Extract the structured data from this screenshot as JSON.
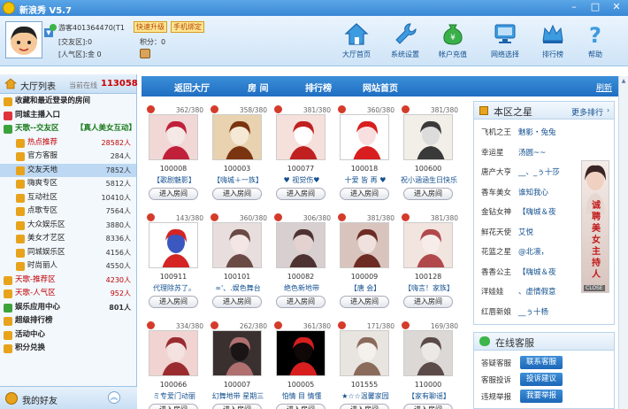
{
  "window": {
    "title": "新浪秀 V5.7"
  },
  "user": {
    "name": "游客401364470(T1",
    "upgrade_label": "快速升级",
    "bind_label": "手机绑定",
    "friend_zone_label": "[交友区]:",
    "friend_zone_value": "0",
    "points_label": "积分",
    "points_value": "0",
    "popular_zone_label": "[人气区]:",
    "popular_zone_value": "金 0"
  },
  "toolbar": [
    {
      "label": "大厅首页",
      "icon": "house-icon"
    },
    {
      "label": "系统设置",
      "icon": "wrench-icon"
    },
    {
      "label": "帐户充值",
      "icon": "money-bag-icon"
    },
    {
      "label": "网络选择",
      "icon": "network-icon"
    },
    {
      "label": "排行榜",
      "icon": "crown-icon"
    },
    {
      "label": "帮助",
      "icon": "help-icon"
    }
  ],
  "hall": {
    "title": "大厅列表",
    "online_label": "当前在线",
    "online_count": "113058"
  },
  "tree": [
    {
      "label": "收藏和最近登录的房间",
      "count": "",
      "indent": 0,
      "bold": true,
      "color": "#222222",
      "icon_color": "#e8a31c"
    },
    {
      "label": "同城主播入口",
      "count": "",
      "indent": 0,
      "bold": true,
      "color": "#222222",
      "icon_color": "#e0323c"
    },
    {
      "label": "天歌--交友区",
      "extra": "【真人美女互动】",
      "count": "",
      "indent": 0,
      "bold": true,
      "color": "#1a7a1a",
      "icon_color": "#3ca33c"
    },
    {
      "label": "热点推荐",
      "count": "28582人",
      "indent": 1,
      "bold": false,
      "color": "#c00000",
      "icon_color": "#e8a31c"
    },
    {
      "label": "官方客服",
      "count": "284人",
      "indent": 1,
      "bold": false,
      "color": "#222222",
      "icon_color": "#e8a31c"
    },
    {
      "label": "交友天地",
      "count": "7852人",
      "indent": 1,
      "bold": false,
      "color": "#222222",
      "icon_color": "#e8a31c",
      "selected": true
    },
    {
      "label": "嗨爽专区",
      "count": "5812人",
      "indent": 1,
      "bold": false,
      "color": "#222222",
      "icon_color": "#e8a31c"
    },
    {
      "label": "互动社区",
      "count": "10410人",
      "indent": 1,
      "bold": false,
      "color": "#222222",
      "icon_color": "#e8a31c"
    },
    {
      "label": "点歌专区",
      "count": "7564人",
      "indent": 1,
      "bold": false,
      "color": "#222222",
      "icon_color": "#e8a31c"
    },
    {
      "label": "大众娱乐区",
      "count": "3880人",
      "indent": 1,
      "bold": false,
      "color": "#222222",
      "icon_color": "#e8a31c"
    },
    {
      "label": "美女才艺区",
      "count": "8336人",
      "indent": 1,
      "bold": false,
      "color": "#222222",
      "icon_color": "#e8a31c"
    },
    {
      "label": "同城娱乐区",
      "count": "4156人",
      "indent": 1,
      "bold": false,
      "color": "#222222",
      "icon_color": "#e8a31c"
    },
    {
      "label": "时尚丽人",
      "count": "4550人",
      "indent": 1,
      "bold": false,
      "color": "#222222",
      "icon_color": "#e8a31c"
    },
    {
      "label": "天歌-推荐区",
      "count": "4230人",
      "indent": 0,
      "bold": false,
      "color": "#c00000",
      "icon_color": "#e8a31c"
    },
    {
      "label": "天歌-人气区",
      "count": "952人",
      "indent": 0,
      "bold": false,
      "color": "#c00000",
      "icon_color": "#e8a31c"
    },
    {
      "label": "娱乐应用中心",
      "count": "801人",
      "indent": 0,
      "bold": true,
      "color": "#222222",
      "icon_color": "#3ca33c"
    },
    {
      "label": "超级排行榜",
      "count": "",
      "indent": 0,
      "bold": true,
      "color": "#222222",
      "icon_color": "#e8a31c"
    },
    {
      "label": "活动中心",
      "count": "",
      "indent": 0,
      "bold": true,
      "color": "#222222",
      "icon_color": "#e8a31c"
    },
    {
      "label": "积分兑换",
      "count": "",
      "indent": 0,
      "bold": true,
      "color": "#222222",
      "icon_color": "#e8a31c"
    }
  ],
  "friends": {
    "label": "我的好友"
  },
  "mainnav": {
    "back": "返回大厅",
    "rooms": "房 间",
    "rank": "排行榜",
    "home": "网站首页",
    "refresh": "刷新"
  },
  "rooms": [
    {
      "count": "362/380",
      "id": "100008",
      "name": "【歌剧魅影】",
      "enter": "进入房间",
      "palette": [
        "#f1d8d6",
        "#c0203a",
        "#f4e9e6"
      ]
    },
    {
      "count": "358/380",
      "id": "100003",
      "name": "【嗨城＋一族】",
      "enter": "进入房间",
      "palette": [
        "#e8d2b0",
        "#7a3410",
        "#f5e9d6"
      ]
    },
    {
      "count": "381/380",
      "id": "100077",
      "name": "♥ 视觉伤♥",
      "enter": "进入房间",
      "palette": [
        "#f6e0dc",
        "#c02020",
        "#ffffff"
      ]
    },
    {
      "count": "360/380",
      "id": "100018",
      "name": "十爱 皆 再 ♥",
      "enter": "进入房间",
      "palette": [
        "#ffffff",
        "#d81e1e",
        "#f8e0e0"
      ]
    },
    {
      "count": "381/380",
      "id": "100600",
      "name": "祝小涵涵生日快乐",
      "enter": "进入房间",
      "palette": [
        "#f2efe8",
        "#3a3a3a",
        "#dcdcdc"
      ]
    },
    {
      "count": "143/380",
      "id": "100911",
      "name": "代理除苏了。",
      "enter": "进入房间",
      "palette": [
        "#ffffff",
        "#d42424",
        "#3a58c0"
      ]
    },
    {
      "count": "360/380",
      "id": "100101",
      "name": "∞'、.娱色舞台",
      "enter": "进入房间",
      "palette": [
        "#e8dede",
        "#6a4a44",
        "#f3e6e4"
      ]
    },
    {
      "count": "306/380",
      "id": "100082",
      "name": "绝色新地带",
      "enter": "进入房间",
      "palette": [
        "#d8cfd0",
        "#4e3232",
        "#e4d2d0"
      ]
    },
    {
      "count": "381/380",
      "id": "100009",
      "name": "【唐 会】",
      "enter": "进入房间",
      "palette": [
        "#d9c4bd",
        "#6c2c24",
        "#efe2de"
      ]
    },
    {
      "count": "381/380",
      "id": "100128",
      "name": "【嗨言！家族】",
      "enter": "进入房间",
      "palette": [
        "#f2e4de",
        "#b0484c",
        "#f7ecea"
      ]
    },
    {
      "count": "334/380",
      "id": "100066",
      "name": "ミ专爱门动丽",
      "enter": "进入房间",
      "palette": [
        "#f1d4d1",
        "#9a2c30",
        "#f4e2e0"
      ]
    },
    {
      "count": "262/380",
      "id": "100007",
      "name": "幻舞地带 星期三",
      "enter": "进入房间",
      "palette": [
        "#3a3030",
        "#b07070",
        "#1a1414"
      ]
    },
    {
      "count": "361/380",
      "id": "100005",
      "name": "怕情 目 情懂",
      "enter": "进入房间",
      "palette": [
        "#000000",
        "#d81e1e",
        "#100808"
      ]
    },
    {
      "count": "171/380",
      "id": "101555",
      "name": "★☆☆温馨家园",
      "enter": "进入房间",
      "palette": [
        "#e8e4e0",
        "#8a6a5a",
        "#f4f0ec"
      ]
    },
    {
      "count": "169/380",
      "id": "110000",
      "name": "【家有聊谣】",
      "enter": "进入房间",
      "palette": [
        "#dcd8d6",
        "#5a4a48",
        "#ece8e6"
      ]
    }
  ],
  "stars": {
    "title": "本区之星",
    "more": "更多排行",
    "rows": [
      {
        "k": "飞机之王",
        "v": "魅影・兔兔"
      },
      {
        "k": "幸运星",
        "v": "汤圆~~"
      },
      {
        "k": "唐产大亨",
        "v": "__、_ぅ十莎"
      },
      {
        "k": "香车美女",
        "v": "谁知我心"
      },
      {
        "k": "金钻女神",
        "v": "【嗨城＆夜"
      },
      {
        "k": "鲜花天使",
        "v": "艾悦"
      },
      {
        "k": "花篮之星",
        "v": "@北凛，"
      },
      {
        "k": "香香公主",
        "v": "【嗨城＆夜"
      },
      {
        "k": "洋娃娃",
        "v": "、虚情假意"
      },
      {
        "k": "红唇新娘",
        "v": "__ぅ十杨"
      }
    ],
    "banner": "诚聘美女主持人",
    "banner_close": "CLOSE"
  },
  "service": {
    "title": "在线客服",
    "rows": [
      {
        "k": "答疑客服",
        "v": "联系客服"
      },
      {
        "k": "客服投诉",
        "v": "投诉建议"
      },
      {
        "k": "违规举报",
        "v": "我要举报"
      }
    ]
  }
}
